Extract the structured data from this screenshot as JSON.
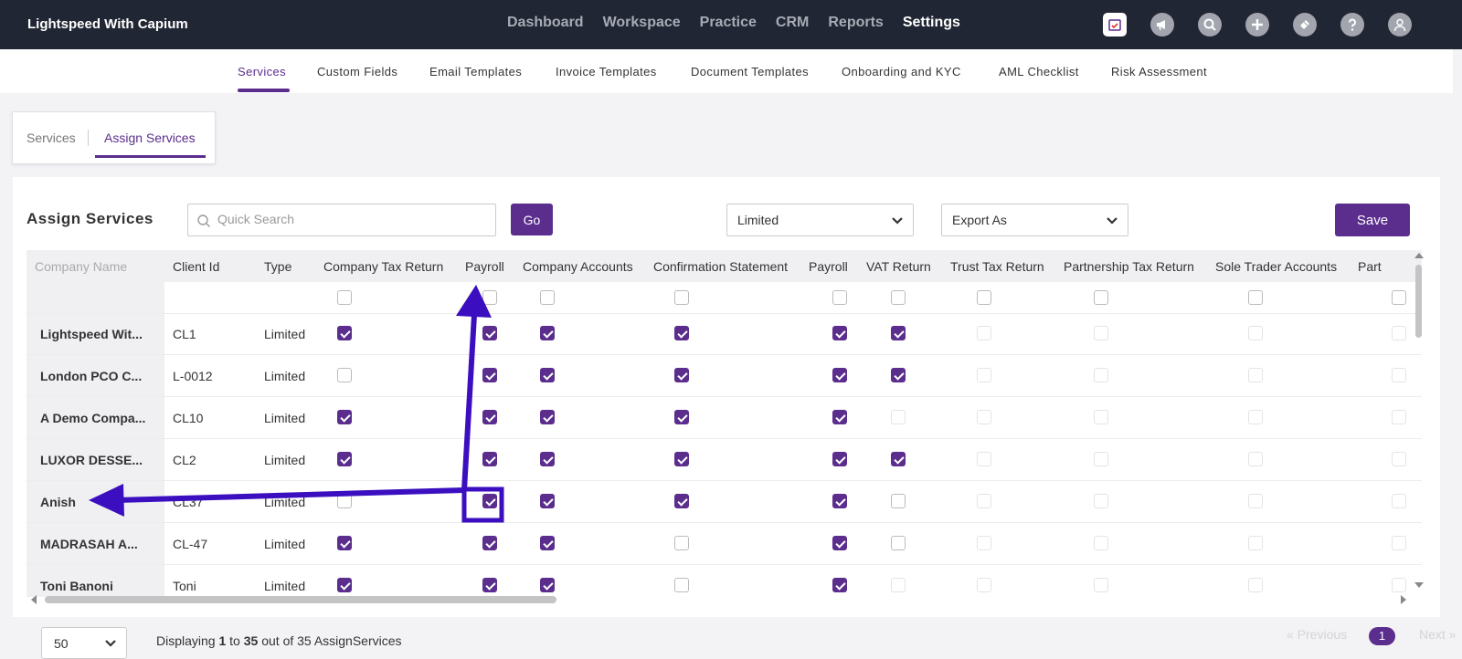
{
  "brand": "Lightspeed With Capium",
  "main_nav": [
    {
      "label": "Dashboard",
      "active": false
    },
    {
      "label": "Workspace",
      "active": false
    },
    {
      "label": "Practice",
      "active": false
    },
    {
      "label": "CRM",
      "active": false
    },
    {
      "label": "Reports",
      "active": false
    },
    {
      "label": "Settings",
      "active": true
    }
  ],
  "nav_icons": [
    "calendar-icon",
    "megaphone-icon",
    "search-icon",
    "plus-icon",
    "ticket-icon",
    "help-icon",
    "user-icon"
  ],
  "sub_nav": [
    "Services",
    "Custom Fields",
    "Email Templates",
    "Invoice Templates",
    "Document Templates",
    "Onboarding and KYC",
    "AML Checklist",
    "Risk Assessment"
  ],
  "inner_tabs": {
    "services": "Services",
    "assign_services": "Assign Services"
  },
  "panel": {
    "title": "Assign Services",
    "search_placeholder": "Quick Search",
    "go_label": "Go",
    "type_filter": "Limited",
    "export_label": "Export As",
    "save_label": "Save"
  },
  "table": {
    "columns": [
      "Company Name",
      "Client Id",
      "Type",
      "Company Tax Return",
      "Payroll",
      "Company Accounts",
      "Confirmation Statement",
      "Payroll",
      "VAT Return",
      "Trust Tax Return",
      "Partnership Tax Return",
      "Sole Trader Accounts",
      "Part"
    ],
    "rows": [
      {
        "name": "Lightspeed Wit...",
        "client_id": "CL1",
        "type": "Limited",
        "checks": [
          1,
          1,
          1,
          1,
          1,
          1,
          -1,
          -1,
          -1,
          -1
        ]
      },
      {
        "name": "London PCO C...",
        "client_id": "L-0012",
        "type": "Limited",
        "checks": [
          0,
          1,
          1,
          1,
          1,
          1,
          -1,
          -1,
          -1,
          -1
        ]
      },
      {
        "name": "A Demo Compa...",
        "client_id": "CL10",
        "type": "Limited",
        "checks": [
          1,
          1,
          1,
          1,
          1,
          -1,
          -1,
          -1,
          -1,
          -1
        ]
      },
      {
        "name": "LUXOR DESSE...",
        "client_id": "CL2",
        "type": "Limited",
        "checks": [
          1,
          1,
          1,
          1,
          1,
          1,
          -1,
          -1,
          -1,
          -1
        ]
      },
      {
        "name": "Anish",
        "client_id": "CL37",
        "type": "Limited",
        "checks": [
          0,
          1,
          1,
          1,
          1,
          0,
          -1,
          -1,
          -1,
          -1
        ]
      },
      {
        "name": "MADRASAH A...",
        "client_id": "CL-47",
        "type": "Limited",
        "checks": [
          1,
          1,
          1,
          0,
          1,
          0,
          -1,
          -1,
          -1,
          -1
        ]
      },
      {
        "name": "Toni Banoni",
        "client_id": "Toni",
        "type": "Limited",
        "checks": [
          1,
          1,
          1,
          0,
          1,
          -1,
          -1,
          -1,
          -1,
          -1
        ]
      }
    ]
  },
  "footer": {
    "page_size": "50",
    "display_prefix": "Displaying ",
    "display_from": "1",
    "display_to_word": " to ",
    "display_to": "35",
    "display_suffix": " out of 35 AssignServices",
    "prev_label": "«  Previous",
    "current_page": "1",
    "next_label": "Next  »"
  },
  "colors": {
    "accent": "#5b2e8e",
    "topbar": "#202633",
    "annotation": "#3b0fbf"
  }
}
